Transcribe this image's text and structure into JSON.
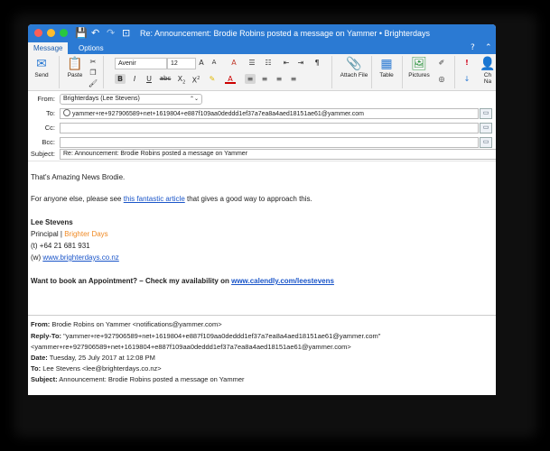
{
  "window": {
    "title": "Re: Announcement: Brodie Robins posted a message on Yammer • Brighterdays"
  },
  "tabs": [
    {
      "label": "Message",
      "active": true
    },
    {
      "label": "Options",
      "active": false
    }
  ],
  "ribbon": {
    "send_label": "Send",
    "paste_label": "Paste",
    "font_name": "Avenir",
    "font_size": "12",
    "bold": "B",
    "italic": "I",
    "underline": "U",
    "strike": "abc",
    "subscript": "X",
    "superscript": "X",
    "attach_label": "Attach File",
    "table_label": "Table",
    "pictures_label": "Pictures",
    "truncated_label": "Ch Na"
  },
  "header": {
    "from_label": "From:",
    "from_value": "Brighterdays (Lee Stevens)",
    "to_label": "To:",
    "to_value": "yammer+re+927906589+net+1619804+e887f109aa0deddd1ef37a7ea8a4aed18151ae61@yammer.com",
    "cc_label": "Cc:",
    "bcc_label": "Bcc:",
    "subject_label": "Subject:",
    "subject_value": "Re: Announcement: Brodie Robins posted a message on Yammer"
  },
  "body": {
    "greeting": "That's Amazing News Brodie.",
    "para_pre": "For anyone else, please see ",
    "para_link": "this fantastic article",
    "para_post": " that gives a good way to approach this.",
    "sig_name": "Lee Stevens",
    "sig_title": "Principal | ",
    "sig_company": "Brighter Days",
    "sig_phone": "(t)  +64 21 681 931",
    "sig_web_prefix": "(w) ",
    "sig_web_link": "www.brighterdays.co.nz",
    "cta_text": "Want to book an Appointment? – Check my availability on ",
    "cta_link": "www.calendly.com/leestevens"
  },
  "quoted": {
    "from_label": "From:",
    "from_value": " Brodie Robins on Yammer <notifications@yammer.com>",
    "replyto_label": "Reply-To:",
    "replyto_value": " \"yammer+re+927906589+net+1619804+e887f109aa0deddd1ef37a7ea8a4aed18151ae61@yammer.com\"",
    "replyto_value2": "<yammer+re+927906589+net+1619804+e887f109aa0deddd1ef37a7ea8a4aed18151ae61@yammer.com>",
    "date_label": "Date:",
    "date_value": " Tuesday, 25 July 2017 at 12:08 PM",
    "to_label": "To:",
    "to_value": " Lee Stevens <lee@brighterdays.co.nz>",
    "subject_label": "Subject:",
    "subject_value": " Announcement: Brodie Robins posted a message on Yammer"
  },
  "colors": {
    "titlebar": "#2b7ad3",
    "link": "#1a55c9",
    "brand_orange": "#f08a24"
  }
}
